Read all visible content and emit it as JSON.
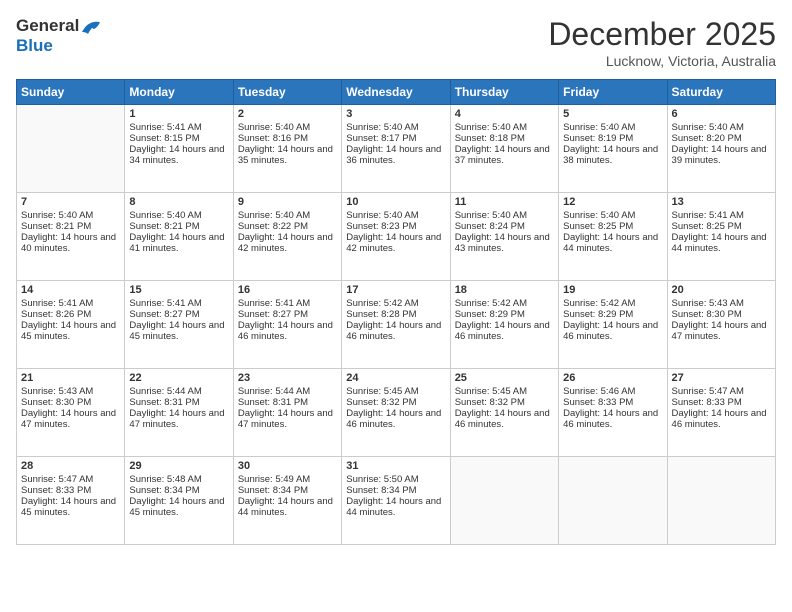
{
  "header": {
    "logo_line1": "General",
    "logo_line2": "Blue",
    "month": "December 2025",
    "location": "Lucknow, Victoria, Australia"
  },
  "weekdays": [
    "Sunday",
    "Monday",
    "Tuesday",
    "Wednesday",
    "Thursday",
    "Friday",
    "Saturday"
  ],
  "weeks": [
    [
      {
        "day": "",
        "empty": true
      },
      {
        "day": "1",
        "sunrise": "Sunrise: 5:41 AM",
        "sunset": "Sunset: 8:15 PM",
        "daylight": "Daylight: 14 hours and 34 minutes."
      },
      {
        "day": "2",
        "sunrise": "Sunrise: 5:40 AM",
        "sunset": "Sunset: 8:16 PM",
        "daylight": "Daylight: 14 hours and 35 minutes."
      },
      {
        "day": "3",
        "sunrise": "Sunrise: 5:40 AM",
        "sunset": "Sunset: 8:17 PM",
        "daylight": "Daylight: 14 hours and 36 minutes."
      },
      {
        "day": "4",
        "sunrise": "Sunrise: 5:40 AM",
        "sunset": "Sunset: 8:18 PM",
        "daylight": "Daylight: 14 hours and 37 minutes."
      },
      {
        "day": "5",
        "sunrise": "Sunrise: 5:40 AM",
        "sunset": "Sunset: 8:19 PM",
        "daylight": "Daylight: 14 hours and 38 minutes."
      },
      {
        "day": "6",
        "sunrise": "Sunrise: 5:40 AM",
        "sunset": "Sunset: 8:20 PM",
        "daylight": "Daylight: 14 hours and 39 minutes."
      }
    ],
    [
      {
        "day": "7",
        "sunrise": "Sunrise: 5:40 AM",
        "sunset": "Sunset: 8:21 PM",
        "daylight": "Daylight: 14 hours and 40 minutes."
      },
      {
        "day": "8",
        "sunrise": "Sunrise: 5:40 AM",
        "sunset": "Sunset: 8:21 PM",
        "daylight": "Daylight: 14 hours and 41 minutes."
      },
      {
        "day": "9",
        "sunrise": "Sunrise: 5:40 AM",
        "sunset": "Sunset: 8:22 PM",
        "daylight": "Daylight: 14 hours and 42 minutes."
      },
      {
        "day": "10",
        "sunrise": "Sunrise: 5:40 AM",
        "sunset": "Sunset: 8:23 PM",
        "daylight": "Daylight: 14 hours and 42 minutes."
      },
      {
        "day": "11",
        "sunrise": "Sunrise: 5:40 AM",
        "sunset": "Sunset: 8:24 PM",
        "daylight": "Daylight: 14 hours and 43 minutes."
      },
      {
        "day": "12",
        "sunrise": "Sunrise: 5:40 AM",
        "sunset": "Sunset: 8:25 PM",
        "daylight": "Daylight: 14 hours and 44 minutes."
      },
      {
        "day": "13",
        "sunrise": "Sunrise: 5:41 AM",
        "sunset": "Sunset: 8:25 PM",
        "daylight": "Daylight: 14 hours and 44 minutes."
      }
    ],
    [
      {
        "day": "14",
        "sunrise": "Sunrise: 5:41 AM",
        "sunset": "Sunset: 8:26 PM",
        "daylight": "Daylight: 14 hours and 45 minutes."
      },
      {
        "day": "15",
        "sunrise": "Sunrise: 5:41 AM",
        "sunset": "Sunset: 8:27 PM",
        "daylight": "Daylight: 14 hours and 45 minutes."
      },
      {
        "day": "16",
        "sunrise": "Sunrise: 5:41 AM",
        "sunset": "Sunset: 8:27 PM",
        "daylight": "Daylight: 14 hours and 46 minutes."
      },
      {
        "day": "17",
        "sunrise": "Sunrise: 5:42 AM",
        "sunset": "Sunset: 8:28 PM",
        "daylight": "Daylight: 14 hours and 46 minutes."
      },
      {
        "day": "18",
        "sunrise": "Sunrise: 5:42 AM",
        "sunset": "Sunset: 8:29 PM",
        "daylight": "Daylight: 14 hours and 46 minutes."
      },
      {
        "day": "19",
        "sunrise": "Sunrise: 5:42 AM",
        "sunset": "Sunset: 8:29 PM",
        "daylight": "Daylight: 14 hours and 46 minutes."
      },
      {
        "day": "20",
        "sunrise": "Sunrise: 5:43 AM",
        "sunset": "Sunset: 8:30 PM",
        "daylight": "Daylight: 14 hours and 47 minutes."
      }
    ],
    [
      {
        "day": "21",
        "sunrise": "Sunrise: 5:43 AM",
        "sunset": "Sunset: 8:30 PM",
        "daylight": "Daylight: 14 hours and 47 minutes."
      },
      {
        "day": "22",
        "sunrise": "Sunrise: 5:44 AM",
        "sunset": "Sunset: 8:31 PM",
        "daylight": "Daylight: 14 hours and 47 minutes."
      },
      {
        "day": "23",
        "sunrise": "Sunrise: 5:44 AM",
        "sunset": "Sunset: 8:31 PM",
        "daylight": "Daylight: 14 hours and 47 minutes."
      },
      {
        "day": "24",
        "sunrise": "Sunrise: 5:45 AM",
        "sunset": "Sunset: 8:32 PM",
        "daylight": "Daylight: 14 hours and 46 minutes."
      },
      {
        "day": "25",
        "sunrise": "Sunrise: 5:45 AM",
        "sunset": "Sunset: 8:32 PM",
        "daylight": "Daylight: 14 hours and 46 minutes."
      },
      {
        "day": "26",
        "sunrise": "Sunrise: 5:46 AM",
        "sunset": "Sunset: 8:33 PM",
        "daylight": "Daylight: 14 hours and 46 minutes."
      },
      {
        "day": "27",
        "sunrise": "Sunrise: 5:47 AM",
        "sunset": "Sunset: 8:33 PM",
        "daylight": "Daylight: 14 hours and 46 minutes."
      }
    ],
    [
      {
        "day": "28",
        "sunrise": "Sunrise: 5:47 AM",
        "sunset": "Sunset: 8:33 PM",
        "daylight": "Daylight: 14 hours and 45 minutes."
      },
      {
        "day": "29",
        "sunrise": "Sunrise: 5:48 AM",
        "sunset": "Sunset: 8:34 PM",
        "daylight": "Daylight: 14 hours and 45 minutes."
      },
      {
        "day": "30",
        "sunrise": "Sunrise: 5:49 AM",
        "sunset": "Sunset: 8:34 PM",
        "daylight": "Daylight: 14 hours and 44 minutes."
      },
      {
        "day": "31",
        "sunrise": "Sunrise: 5:50 AM",
        "sunset": "Sunset: 8:34 PM",
        "daylight": "Daylight: 14 hours and 44 minutes."
      },
      {
        "day": "",
        "empty": true
      },
      {
        "day": "",
        "empty": true
      },
      {
        "day": "",
        "empty": true
      }
    ]
  ]
}
